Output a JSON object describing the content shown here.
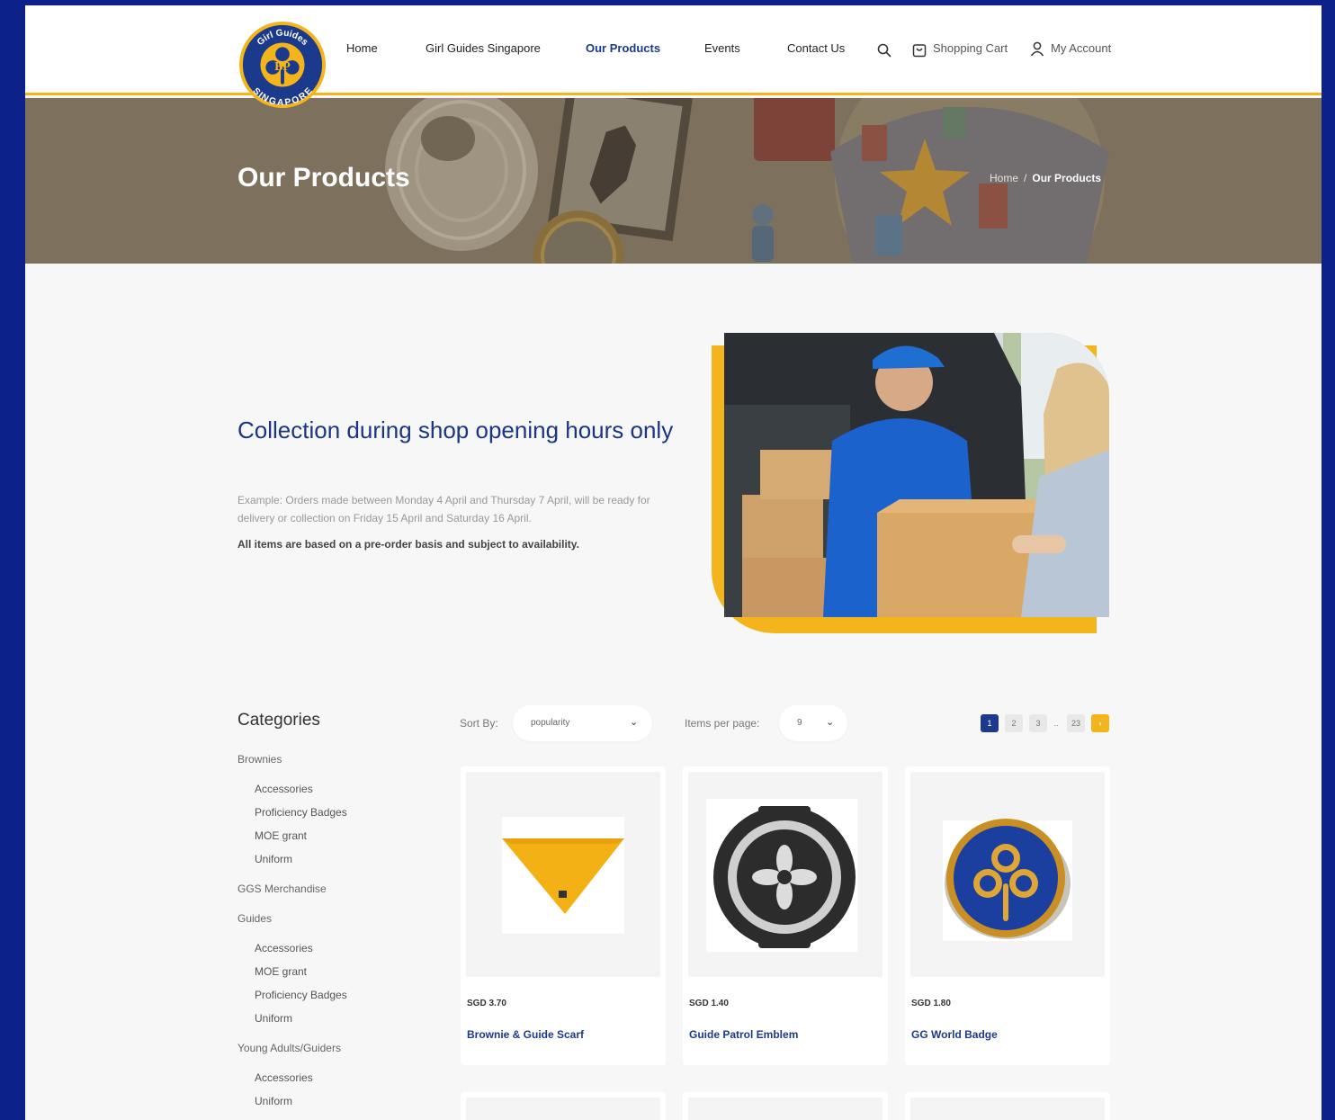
{
  "brand": {
    "logo_text_top": "Girl Guides",
    "logo_text_bottom": "SINGAPORE",
    "logo_monogram": "BP"
  },
  "nav": {
    "items": [
      "Home",
      "Girl Guides Singapore",
      "Our Products",
      "Events",
      "Contact Us"
    ],
    "active": "Our Products",
    "search_icon": "search-icon",
    "cart_label": "Shopping Cart",
    "cart_icon": "shopping-bag-icon",
    "account_label": "My Account",
    "account_icon": "user-icon"
  },
  "hero": {
    "title": "Our Products",
    "breadcrumb": {
      "home": "Home",
      "separator": "/",
      "current": "Our Products"
    }
  },
  "intro": {
    "title": "Collection during shop opening hours only",
    "body": "Example: Orders made between Monday 4 April and Thursday 7 April, will be ready for delivery or collection on Friday 15 April and Saturday 16 April.",
    "note": "All items are based on a pre-order basis and subject to availability."
  },
  "categories": {
    "title": "Categories",
    "groups": [
      {
        "label": "Brownies",
        "children": [
          "Accessories",
          "Proficiency Badges",
          "MOE grant",
          "Uniform"
        ]
      },
      {
        "label": "GGS Merchandise",
        "children": []
      },
      {
        "label": "Guides",
        "children": [
          "Accessories",
          "MOE grant",
          "Proficiency Badges",
          "Uniform"
        ]
      },
      {
        "label": "Young Adults/Guiders",
        "children": [
          "Accessories",
          "Uniform"
        ]
      }
    ]
  },
  "toolbar": {
    "sort_label": "Sort By:",
    "sort_value": "popularity",
    "items_per_page_label": "Items per page:",
    "items_per_page_value": "9",
    "pages": [
      "1",
      "2",
      "3",
      "..",
      "23"
    ],
    "current_page": "1",
    "next_icon": "chevron-right-icon"
  },
  "products": [
    {
      "price": "SGD 3.70",
      "name": "Brownie & Guide Scarf",
      "image": "yellow-scarf"
    },
    {
      "price": "SGD 1.40",
      "name": "Guide Patrol Emblem",
      "image": "girl-guides-patch"
    },
    {
      "price": "SGD 1.80",
      "name": "GG World Badge",
      "image": "world-badge-pin"
    }
  ],
  "colors": {
    "navy": "#1c3a8c",
    "gold": "#f3b51b",
    "frame": "#0c228a",
    "hero_overlay": "#7d715d"
  }
}
